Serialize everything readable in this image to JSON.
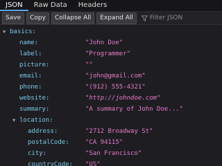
{
  "tabs": [
    {
      "label": "JSON",
      "active": true
    },
    {
      "label": "Raw Data",
      "active": false
    },
    {
      "label": "Headers",
      "active": false
    }
  ],
  "toolbar": {
    "save": "Save",
    "copy": "Copy",
    "collapse_all": "Collapse All",
    "expand_all": "Expand All",
    "filter_placeholder": "Filter JSON"
  },
  "tree": {
    "basics_key": "basics:",
    "fields": [
      {
        "key": "name:",
        "value": "\"John Doe\""
      },
      {
        "key": "label:",
        "value": "\"Programmer\""
      },
      {
        "key": "picture:",
        "value": "\"\""
      },
      {
        "key": "email:",
        "value": "\"john@gmail.com\""
      },
      {
        "key": "phone:",
        "value": "\"(912) 555-4321\""
      },
      {
        "key": "website:",
        "value": "\"http://johndoe.com\""
      },
      {
        "key": "summary:",
        "value": "\"A summary of John Doe...\""
      }
    ],
    "location_key": "location:",
    "location_fields": [
      {
        "key": "address:",
        "value": "\"2712 Broadway St\""
      },
      {
        "key": "postalCode:",
        "value": "\"CA 94115\""
      },
      {
        "key": "city:",
        "value": "\"San Francisco\""
      },
      {
        "key": "countryCode:",
        "value": "\"US\""
      }
    ]
  },
  "colors": {
    "key": "#7cc8e8",
    "string": "#e879c9",
    "accent": "#5aa5e6"
  }
}
